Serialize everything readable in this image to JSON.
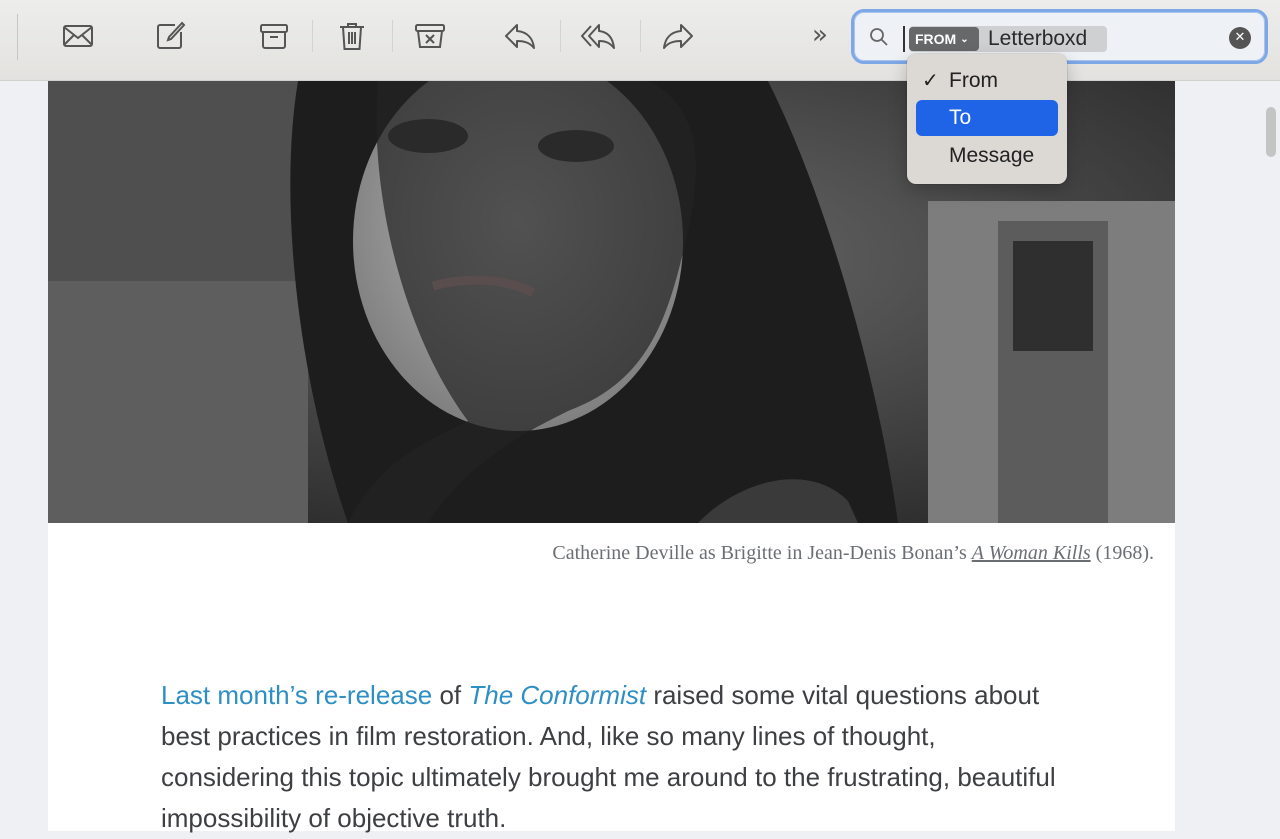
{
  "toolbar": {
    "buttons": [
      {
        "name": "get-mail",
        "icon": "envelope-icon"
      },
      {
        "name": "compose",
        "icon": "compose-icon"
      },
      {
        "name": "archive",
        "icon": "archive-icon"
      },
      {
        "name": "delete",
        "icon": "trash-icon"
      },
      {
        "name": "junk",
        "icon": "junk-icon"
      },
      {
        "name": "reply",
        "icon": "reply-icon"
      },
      {
        "name": "reply-all",
        "icon": "reply-all-icon"
      },
      {
        "name": "forward",
        "icon": "forward-icon"
      }
    ],
    "more_label": "»"
  },
  "search": {
    "token_tag": "FROM",
    "token_text": "Letterboxd",
    "clear_glyph": "✕",
    "accent_color": "#7ea7e6"
  },
  "scope_menu": {
    "items": [
      {
        "label": "From",
        "checked": true,
        "selected": false
      },
      {
        "label": "To",
        "checked": false,
        "selected": true
      },
      {
        "label": "Message",
        "checked": false,
        "selected": false
      }
    ],
    "check_glyph": "✓",
    "highlight_color": "#1f63e6"
  },
  "message": {
    "caption_prefix": "Catherine Deville as Brigitte in Jean-Denis Bonan’s ",
    "caption_title": "A Woman Kills",
    "caption_suffix": " (1968).",
    "link_text": "Last month’s re-release",
    "text_of": " of ",
    "film_title": "The Conformist",
    "text_rest": " raised some vital questions about best practices in film restoration. And, like so many lines of thought, considering this topic ultimately brought me around to the frustrating, beautiful impossibility of objective truth.",
    "link_color": "#2e8fc4"
  }
}
